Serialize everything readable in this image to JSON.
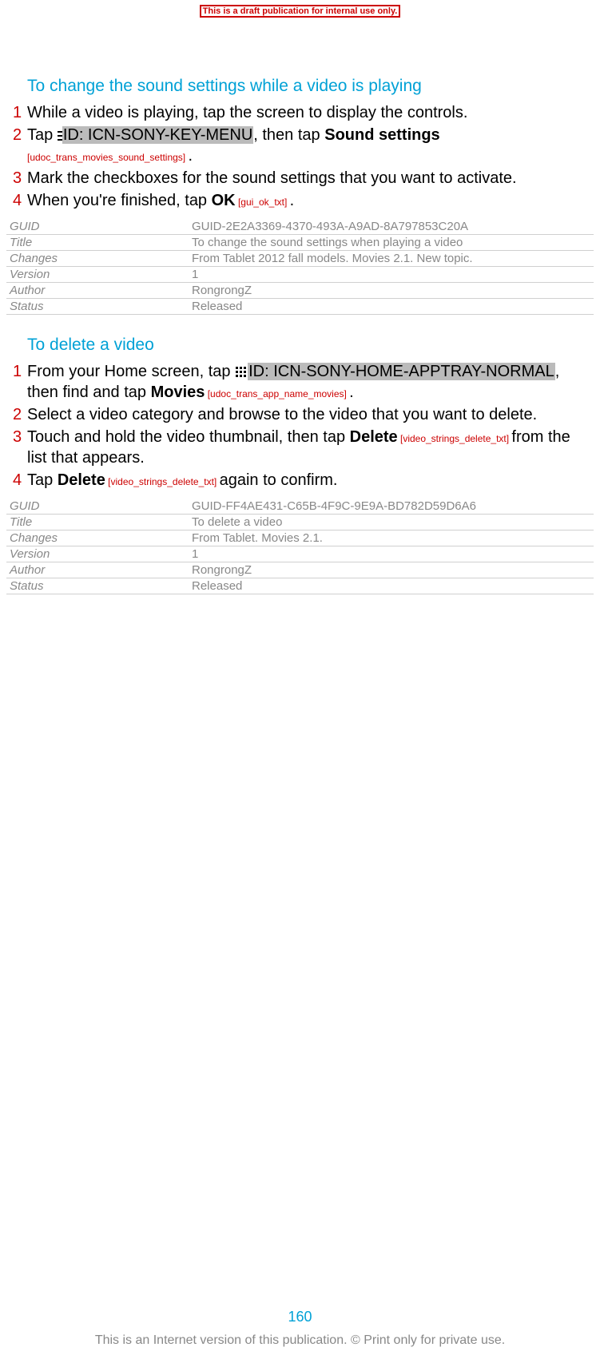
{
  "banner": "This is a draft publication for internal use only.",
  "section1": {
    "title": "To change the sound settings while a video is playing",
    "steps": [
      {
        "n": "1",
        "pre": "While a video is playing, tap the screen to display the controls."
      },
      {
        "n": "2",
        "pre": "Tap ",
        "icon": "menu",
        "id": "ID: ICN-SONY-KEY-MENU",
        "mid": ", then tap ",
        "bold": "Sound settings",
        "trans": " [udoc_trans_movies_sound_settings] ",
        "post": "."
      },
      {
        "n": "3",
        "pre": "Mark the checkboxes for the sound settings that you want to activate."
      },
      {
        "n": "4",
        "pre": "When you're finished, tap ",
        "bold": "OK",
        "trans": " [gui_ok_txt] ",
        "post": "."
      }
    ]
  },
  "meta1": [
    {
      "k": "GUID",
      "v": "GUID-2E2A3369-4370-493A-A9AD-8A797853C20A"
    },
    {
      "k": "Title",
      "v": "To change the sound settings when playing a video"
    },
    {
      "k": "Changes",
      "v": "From Tablet 2012 fall models. Movies 2.1. New topic."
    },
    {
      "k": "Version",
      "v": "1"
    },
    {
      "k": "Author",
      "v": "RongrongZ"
    },
    {
      "k": "Status",
      "v": "Released"
    }
  ],
  "section2": {
    "title": "To delete a video",
    "steps": [
      {
        "n": "1",
        "pre": "From your Home screen, tap ",
        "icon": "grid",
        "id": "ID: ICN-SONY-HOME-APPTRAY-NORMAL",
        "mid": ", then find and tap ",
        "bold": "Movies",
        "trans": " [udoc_trans_app_name_movies] ",
        "post": "."
      },
      {
        "n": "2",
        "pre": "Select a video category and browse to the video that you want to delete."
      },
      {
        "n": "3",
        "pre": "Touch and hold the video thumbnail, then tap ",
        "bold": "Delete",
        "trans": " [video_strings_delete_txt] ",
        "post": "from the list that appears."
      },
      {
        "n": "4",
        "pre": "Tap ",
        "bold": "Delete",
        "trans": " [video_strings_delete_txt] ",
        "post": "again to confirm."
      }
    ]
  },
  "meta2": [
    {
      "k": "GUID",
      "v": "GUID-FF4AE431-C65B-4F9C-9E9A-BD782D59D6A6"
    },
    {
      "k": "Title",
      "v": "To delete a video"
    },
    {
      "k": "Changes",
      "v": "From Tablet. Movies 2.1."
    },
    {
      "k": "Version",
      "v": "1"
    },
    {
      "k": "Author",
      "v": "RongrongZ"
    },
    {
      "k": "Status",
      "v": "Released"
    }
  ],
  "pageNumber": "160",
  "footer": "This is an Internet version of this publication. © Print only for private use."
}
